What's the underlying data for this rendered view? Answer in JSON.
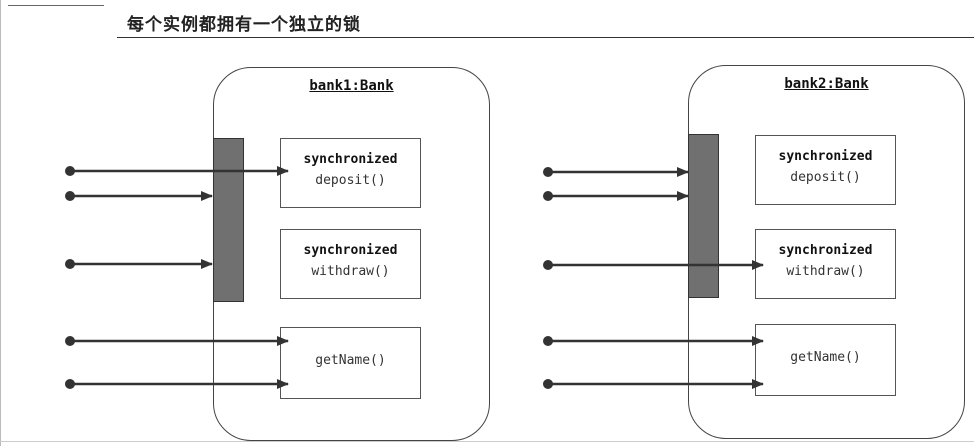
{
  "title": "每个实例都拥有一个独立的锁",
  "objects": [
    {
      "name": "bank1:Bank",
      "methods": [
        {
          "modifier": "synchronized",
          "name": "deposit()"
        },
        {
          "modifier": "synchronized",
          "name": "withdraw()"
        },
        {
          "modifier": "",
          "name": "getName()"
        }
      ]
    },
    {
      "name": "bank2:Bank",
      "methods": [
        {
          "modifier": "synchronized",
          "name": "deposit()"
        },
        {
          "modifier": "synchronized",
          "name": "withdraw()"
        },
        {
          "modifier": "",
          "name": "getName()"
        }
      ]
    }
  ]
}
